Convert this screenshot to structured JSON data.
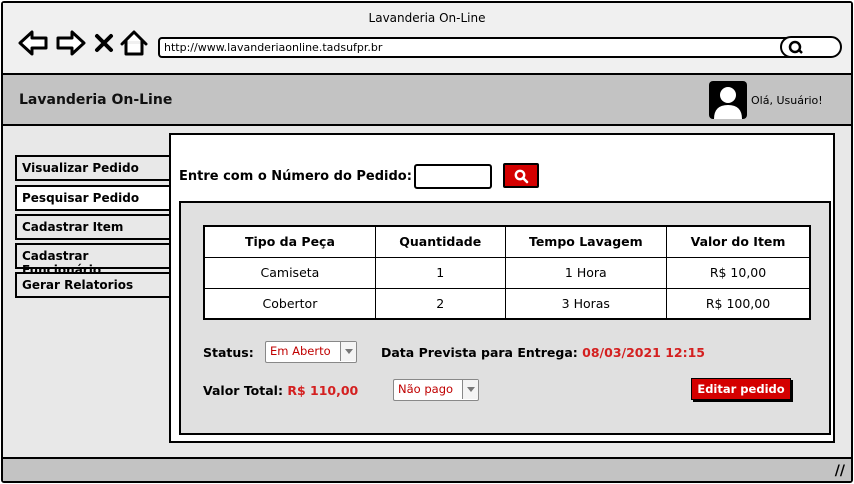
{
  "browser": {
    "window_title": "Lavanderia On-Line",
    "url": "http://www.lavanderiaonline.tadsufpr.br"
  },
  "header": {
    "app_title": "Lavanderia On-Line",
    "greeting": "Olá, Usuário!"
  },
  "sidebar": {
    "items": [
      {
        "label": "Visualizar Pedido",
        "active": false
      },
      {
        "label": "Pesquisar Pedido",
        "active": true
      },
      {
        "label": "Cadastrar Item",
        "active": false
      },
      {
        "label": "Cadastrar Funcionário",
        "active": false
      },
      {
        "label": "Gerar Relatorios",
        "active": false
      }
    ]
  },
  "search": {
    "label": "Entre com o Número do Pedido:",
    "value": ""
  },
  "table": {
    "headers": [
      "Tipo da Peça",
      "Quantidade",
      "Tempo Lavagem",
      "Valor do Item"
    ],
    "rows": [
      [
        "Camiseta",
        "1",
        "1 Hora",
        "R$ 10,00"
      ],
      [
        "Cobertor",
        "2",
        "3 Horas",
        "R$ 100,00"
      ]
    ]
  },
  "order": {
    "status_label": "Status:",
    "status_value": "Em Aberto",
    "delivery_label": "Data Prevista para Entrega:",
    "delivery_value": "08/03/2021 12:15",
    "total_label": "Valor Total:",
    "total_value": "R$ 110,00",
    "payment_value": "Não pago",
    "edit_button": "Editar pedido"
  },
  "colors": {
    "accent": "#d40000",
    "header_bg": "#c3c3c3"
  }
}
